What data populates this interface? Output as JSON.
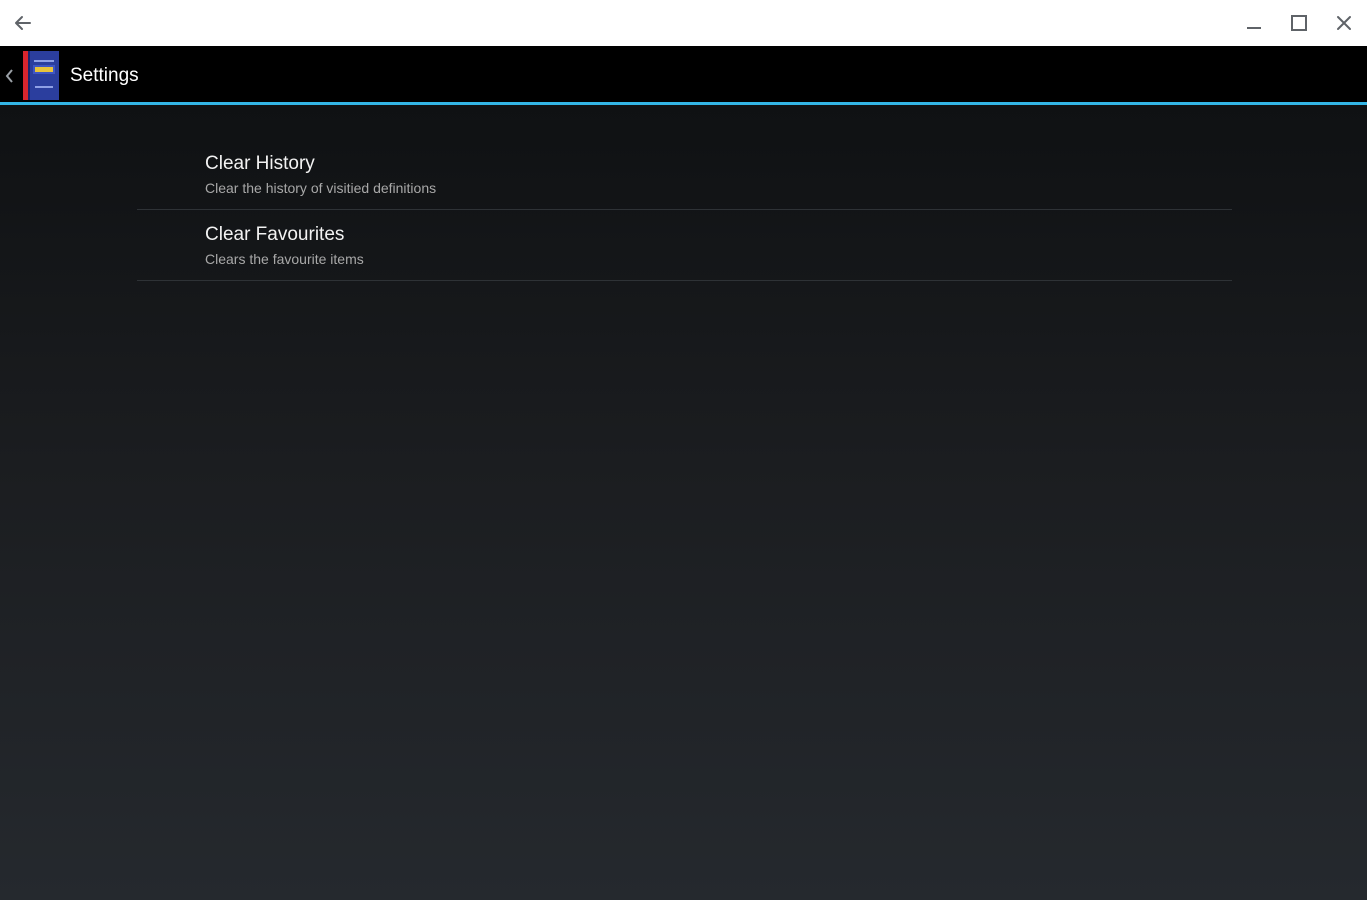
{
  "window": {
    "back_icon": "arrow-left-icon",
    "minimize_icon": "minimize-icon",
    "maximize_icon": "maximize-icon",
    "close_icon": "close-icon"
  },
  "actionbar": {
    "title": "Settings",
    "up_icon": "chevron-left-icon",
    "app_icon": "dictionary-book-icon",
    "background": "#000000",
    "accent": "#33b5e5"
  },
  "preferences": [
    {
      "title": "Clear History",
      "summary": "Clear the history of visitied definitions"
    },
    {
      "title": "Clear Favourites",
      "summary": "Clears the favourite items"
    }
  ]
}
